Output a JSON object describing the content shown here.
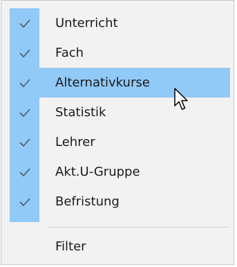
{
  "menu": {
    "items": [
      {
        "label": "Unterricht",
        "checked": true,
        "icon": "checkmark-icon"
      },
      {
        "label": "Fach",
        "checked": true,
        "icon": "checkmark-icon"
      },
      {
        "label": "Alternativkurse",
        "checked": true,
        "highlighted": true,
        "icon": "checkmark-icon"
      },
      {
        "label": "Statistik",
        "checked": true,
        "icon": "checkmark-icon"
      },
      {
        "label": "Lehrer",
        "checked": true,
        "icon": "checkmark-icon"
      },
      {
        "label": "Akt.U-Gruppe",
        "checked": true,
        "icon": "checkmark-icon"
      },
      {
        "label": "Befristung",
        "checked": true,
        "icon": "checkmark-icon"
      }
    ],
    "footer_item": {
      "label": "Filter"
    }
  },
  "colors": {
    "menu_background": "#f2f2f2",
    "highlight": "#91c9f7",
    "check_strip": "#91c9f7",
    "checkmark": "#4a5a6a"
  },
  "cursor": {
    "icon": "mouse-pointer-icon"
  }
}
